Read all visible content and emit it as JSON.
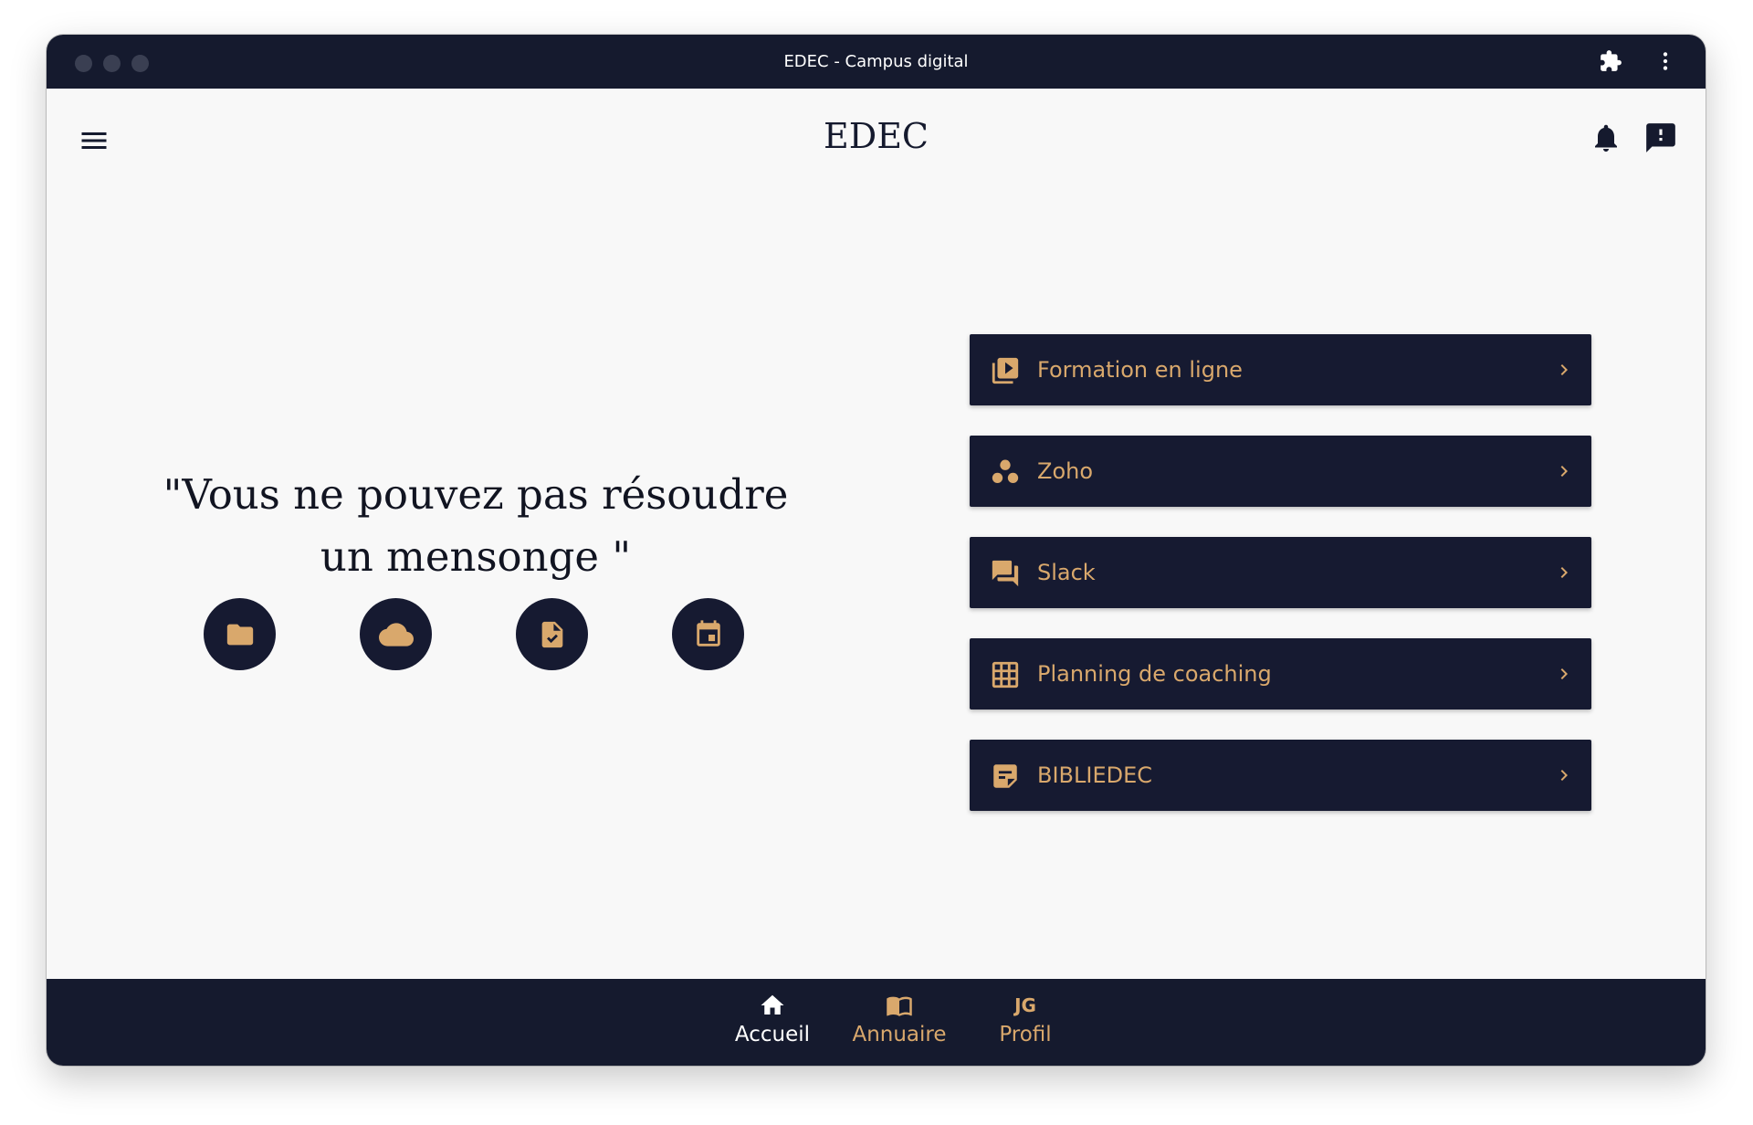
{
  "window": {
    "title": "EDEC - Campus digital"
  },
  "app": {
    "brand": "EDEC"
  },
  "quote": {
    "text": "\"Vous ne pouvez pas résoudre un mensonge \""
  },
  "quick_actions": [
    {
      "icon": "folder-icon"
    },
    {
      "icon": "cloud-icon"
    },
    {
      "icon": "file-check-icon"
    },
    {
      "icon": "calendar-icon"
    }
  ],
  "links": [
    {
      "label": "Formation en ligne",
      "icon": "video-library-icon"
    },
    {
      "label": "Zoho",
      "icon": "workspaces-icon"
    },
    {
      "label": "Slack",
      "icon": "forum-icon"
    },
    {
      "label": "Planning de coaching",
      "icon": "grid-icon"
    },
    {
      "label": "BIBLIEDEC",
      "icon": "sticky-note-icon"
    }
  ],
  "bottom_nav": {
    "items": [
      {
        "label": "Accueil",
        "icon": "home-icon",
        "active": true
      },
      {
        "label": "Annuaire",
        "icon": "book-icon",
        "active": false
      },
      {
        "label": "Profil",
        "initials": "JG",
        "active": false
      }
    ]
  },
  "colors": {
    "navy": "#151a2e",
    "gold": "#d9a86c",
    "background": "#f8f8f8",
    "active_nav": "#ffffff"
  }
}
